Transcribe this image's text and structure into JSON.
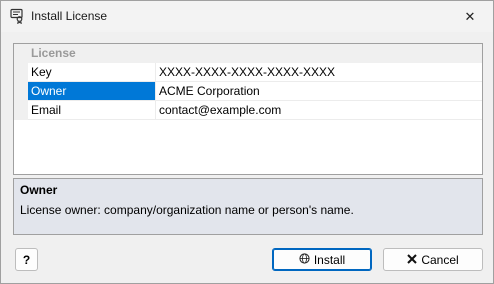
{
  "window": {
    "title": "Install License",
    "close_glyph": "✕"
  },
  "grid": {
    "group_label": "License",
    "rows": [
      {
        "name": "Key",
        "value": "XXXX-XXXX-XXXX-XXXX-XXXX"
      },
      {
        "name": "Owner",
        "value": "ACME Corporation",
        "selected": true
      },
      {
        "name": "Email",
        "value": "contact@example.com"
      }
    ]
  },
  "description": {
    "title": "Owner",
    "text": "License owner: company/organization name or person's name."
  },
  "buttons": {
    "help_label": "?",
    "install_label": "Install",
    "cancel_label": "Cancel"
  },
  "colors": {
    "selection": "#0078d7",
    "description_bg": "#e2e5ec",
    "default_button_border": "#0067c0"
  },
  "icons": {
    "title": "license-icon",
    "install": "globe-icon",
    "cancel": "x-icon"
  }
}
